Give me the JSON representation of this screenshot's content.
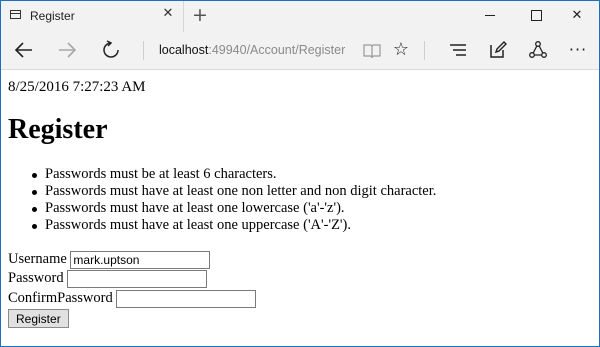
{
  "browser": {
    "tab": {
      "title": "Register",
      "page_icon": "page-icon",
      "close_icon": "close-icon"
    },
    "new_tab_icon": "plus-icon",
    "window_controls": {
      "minimize_icon": "minimize-icon",
      "maximize_icon": "maximize-icon",
      "close_icon": "close-icon"
    },
    "toolbar": {
      "back_icon": "back-arrow-icon",
      "forward_icon": "forward-arrow-icon",
      "refresh_icon": "refresh-icon",
      "address": {
        "host": "localhost",
        "path": ":49940/Account/Register"
      },
      "reading_view_icon": "reading-view-icon",
      "favorite_icon": "star-icon",
      "hub_icon": "hub-icon",
      "web_note_icon": "web-note-icon",
      "share_icon": "share-icon",
      "more_icon": "more-icon"
    },
    "colors": {
      "frame_border": "#1e6fbf",
      "chrome_bg": "#f2f2f2",
      "address_path": "#8a8a8a"
    }
  },
  "page": {
    "timestamp": "8/25/2016 7:27:23 AM",
    "title": "Register",
    "password_rules": [
      "Passwords must be at least 6 characters.",
      "Passwords must have at least one non letter and non digit character.",
      "Passwords must have at least one lowercase ('a'-'z').",
      "Passwords must have at least one uppercase ('A'-'Z')."
    ],
    "form": {
      "username_label": "Username",
      "username_value": "mark.uptson",
      "password_label": "Password",
      "password_value": "",
      "confirm_label": "ConfirmPassword",
      "confirm_value": "",
      "submit_label": "Register"
    }
  }
}
